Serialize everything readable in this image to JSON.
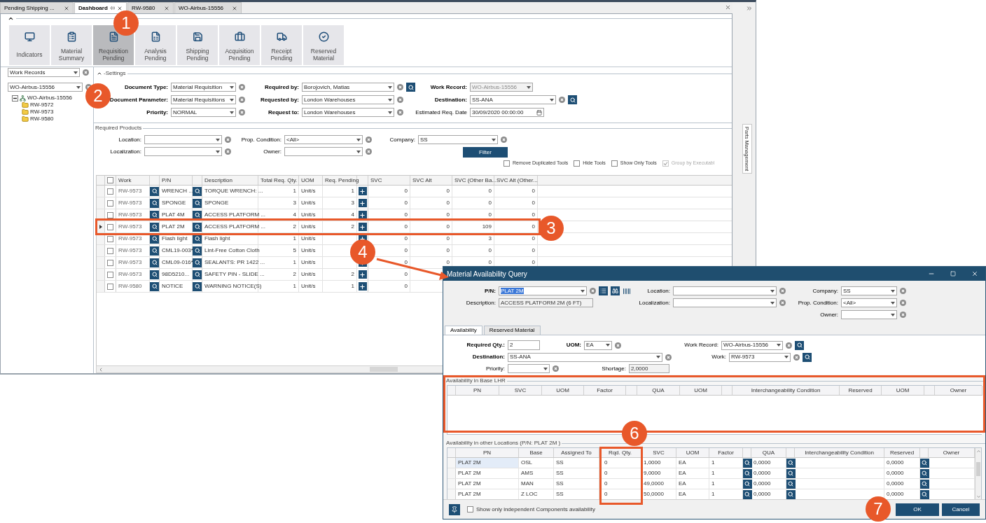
{
  "main_window": {
    "tabs": [
      {
        "label": "Pending Shipping ...",
        "selected": false,
        "pinned": false
      },
      {
        "label": "Dashboard",
        "selected": true,
        "pinned": true
      },
      {
        "label": "RW-9580",
        "selected": false,
        "pinned": false
      },
      {
        "label": "WO-Airbus-15556",
        "selected": false,
        "pinned": false
      }
    ],
    "tiles": [
      {
        "label": "Indicators",
        "selected": false
      },
      {
        "label": "Material Summary",
        "selected": false
      },
      {
        "label": "Requisition Pending",
        "selected": true
      },
      {
        "label": "Analysis Pending",
        "selected": false
      },
      {
        "label": "Shipping Pending",
        "selected": false
      },
      {
        "label": "Acquisition Pending",
        "selected": false
      },
      {
        "label": "Receipt Pending",
        "selected": false
      },
      {
        "label": "Reserved Material",
        "selected": false
      }
    ],
    "left_panel": {
      "filter": "Work Records",
      "record": "WO-Airbus-15556",
      "tree": [
        {
          "label": "WO-Airbus-15556",
          "expanded": true,
          "children": [
            {
              "label": "RW-9572"
            },
            {
              "label": "RW-9573"
            },
            {
              "label": "RW-9580"
            }
          ]
        }
      ]
    },
    "settings": {
      "title": "-Settings",
      "rows": [
        [
          {
            "label": "Document Type:",
            "value": "Material Requisition",
            "kind": "dropdown",
            "required": true
          },
          {
            "label": "Required by:",
            "value": "Borojovich, Matias",
            "kind": "dropdown",
            "required": true,
            "search": true
          },
          {
            "label": "Work Record:",
            "value": "WO-Airbus-15556",
            "kind": "dropdown",
            "required": true,
            "disabled": true
          }
        ],
        [
          {
            "label": "Document Parameter:",
            "value": "Material Requisitions",
            "kind": "dropdown",
            "required": true
          },
          {
            "label": "Requested by:",
            "value": "London Warehouses",
            "kind": "dropdown",
            "required": true
          },
          {
            "label": "Destination:",
            "value": "SS-ANA",
            "kind": "dropdown",
            "required": true,
            "search": true
          }
        ],
        [
          {
            "label": "Priority:",
            "value": "NORMAL",
            "kind": "dropdown",
            "required": true
          },
          {
            "label": "Request to:",
            "value": "London Warehouses",
            "kind": "dropdown",
            "required": true
          },
          {
            "label": "Estimated Req. Date",
            "value": "30/09/2020 00:00:00",
            "kind": "date",
            "required": false
          }
        ]
      ]
    },
    "required_products": {
      "title": "Required Products",
      "rows": [
        [
          {
            "label": "Location:",
            "kind": "dropdown",
            "required": false
          },
          {
            "label": "Prop. Condition:",
            "value": "<All>",
            "kind": "dropdown",
            "required": false
          },
          {
            "label": "Company:",
            "value": "SS",
            "kind": "dropdown",
            "required": false
          }
        ],
        [
          {
            "label": "Localization:",
            "kind": "dropdown",
            "required": false
          },
          {
            "label": "Owner:",
            "kind": "dropdown",
            "required": false
          }
        ]
      ],
      "filter_button": "Filter"
    },
    "options": [
      {
        "label": "Remove Duplicated Tools",
        "checked": false,
        "disabled": false
      },
      {
        "label": "Hide Tools",
        "checked": false,
        "disabled": false
      },
      {
        "label": "Show Only Tools",
        "checked": false,
        "disabled": false
      },
      {
        "label": "Group by Executabl",
        "checked": true,
        "disabled": true
      }
    ],
    "table": {
      "select_all_checked": false,
      "columns": [
        "Work",
        "P/N",
        "Description",
        "Total Req. Qty.",
        "UOM",
        "Req. Pending",
        "SVC",
        "SVC Alt",
        "SVC (Other Ba...",
        "SVC Alt (Other..."
      ],
      "rows": [
        {
          "selected": false,
          "checked": false,
          "work": "RW-9573",
          "pn": "WRENCH ...",
          "description": "TORQUE WRENCH: ...",
          "total": "1",
          "uom": "Unit/s",
          "pending": "1",
          "svc": "0",
          "svc_alt": "0",
          "svc_other": "0",
          "svc_alt_other": "0"
        },
        {
          "selected": false,
          "checked": false,
          "work": "RW-9573",
          "pn": "SPONGE",
          "description": "SPONGE",
          "total": "3",
          "uom": "Unit/s",
          "pending": "3",
          "svc": "0",
          "svc_alt": "0",
          "svc_other": "0",
          "svc_alt_other": "0"
        },
        {
          "selected": false,
          "checked": false,
          "work": "RW-9573",
          "pn": "PLAT 4M",
          "description": "ACCESS PLATFORM ...",
          "total": "4",
          "uom": "Unit/s",
          "pending": "4",
          "svc": "0",
          "svc_alt": "0",
          "svc_other": "0",
          "svc_alt_other": "0"
        },
        {
          "selected": true,
          "checked": false,
          "work": "RW-9573",
          "pn": "PLAT 2M",
          "description": "ACCESS PLATFORM ...",
          "total": "2",
          "uom": "Unit/s",
          "pending": "2",
          "svc": "0",
          "svc_alt": "0",
          "svc_other": "109",
          "svc_alt_other": "0"
        },
        {
          "selected": false,
          "checked": false,
          "work": "RW-9573",
          "pn": "Flash light",
          "description": "Flash light",
          "total": "1",
          "uom": "Unit/s",
          "svc": "0",
          "svc_alt": "0",
          "svc_other": "3",
          "svc_alt_other": "0"
        },
        {
          "selected": false,
          "checked": false,
          "work": "RW-9573",
          "pn": "CML19-003*",
          "description": "Lint-Free Cotton Cloth",
          "total": "5",
          "uom": "Unit/s",
          "svc": "0",
          "svc_alt": "0",
          "svc_other": "0",
          "svc_alt_other": "0"
        },
        {
          "selected": false,
          "checked": false,
          "work": "RW-9573",
          "pn": "CML09-016*",
          "description": "SEALANTS: PR 1422 ...",
          "total": "1",
          "uom": "Unit/s",
          "svc": "0",
          "svc_alt": "0",
          "svc_other": "0",
          "svc_alt_other": "0"
        },
        {
          "selected": false,
          "checked": false,
          "work": "RW-9573",
          "pn": "98D5210...",
          "description": "SAFETY PIN - SLIDE ...",
          "total": "2",
          "uom": "Unit/s",
          "pending": "2",
          "svc": "0"
        },
        {
          "selected": false,
          "checked": false,
          "work": "RW-9580",
          "pn": "NOTICE",
          "description": "WARNING NOTICE(S)",
          "total": "1",
          "uom": "Unit/s",
          "pending": "1",
          "svc": "0"
        }
      ]
    },
    "side_panel": "Parts Management"
  },
  "dialog": {
    "title": "Material Availability Query",
    "query_columns": [
      [
        {
          "label": "P/N:",
          "value": "PLAT 2M",
          "kind": "dropdown",
          "required": true,
          "text_selected": true
        },
        {
          "label": "Description:",
          "value": "ACCESS PLATFORM 2M (6 FT)",
          "kind": "readonly",
          "required": false
        }
      ],
      [
        {
          "label": "Location:",
          "kind": "dropdown",
          "required": false
        },
        {
          "label": "Localization:",
          "kind": "dropdown",
          "required": false
        }
      ],
      [
        {
          "label": "Company:",
          "value": "SS",
          "kind": "dropdown",
          "required": false
        },
        {
          "label": "Prop. Condition:",
          "value": "<All>",
          "kind": "dropdown",
          "required": false
        },
        {
          "label": "Owner:",
          "kind": "dropdown",
          "required": false
        }
      ]
    ],
    "tabs": [
      {
        "label": "Availability",
        "selected": true
      },
      {
        "label": "Reserved Material",
        "selected": false
      }
    ],
    "form": {
      "required_qty": {
        "label": "Required Qty.:",
        "value": "2",
        "kind": "text",
        "required": true
      },
      "uom": {
        "label": "UOM:",
        "value": "EA",
        "kind": "dropdown",
        "required": true
      },
      "work_record": {
        "label": "Work Record:",
        "value": "WO-Airbus-15556",
        "kind": "dropdown",
        "required": false,
        "search": true
      },
      "destination": {
        "label": "Destination:",
        "value": "SS-ANA",
        "kind": "dropdown",
        "required": true
      },
      "work": {
        "label": "Work:",
        "value": "RW-9573",
        "kind": "dropdown",
        "required": false,
        "search": true
      },
      "priority": {
        "label": "Priority:",
        "kind": "dropdown",
        "required": false
      },
      "shortage": {
        "label": "Shortage:",
        "value": "2,0000",
        "kind": "readonly",
        "required": false
      }
    },
    "base_grid": {
      "title": "Availability in Base LHR",
      "columns": [
        {
          "kind": "text",
          "label": "PN"
        },
        {
          "kind": "text",
          "label": "SVC"
        },
        {
          "kind": "text",
          "label": "UOM"
        },
        {
          "kind": "text",
          "label": "Factor"
        },
        {
          "kind": "icon"
        },
        {
          "kind": "text",
          "label": "QUA"
        },
        {
          "kind": "text",
          "label": "UOM"
        },
        {
          "kind": "icon"
        },
        {
          "kind": "text",
          "label": "Interchangeability Condition"
        },
        {
          "kind": "text",
          "label": "Reserved"
        },
        {
          "kind": "text",
          "label": "UOM"
        },
        {
          "kind": "icon"
        },
        {
          "kind": "text",
          "label": "Owner"
        }
      ]
    },
    "other_grid": {
      "title": "Availability in other Locations (P/N: PLAT 2M )",
      "columns": [
        {
          "kind": "text",
          "label": "PN"
        },
        {
          "kind": "text",
          "label": "Base"
        },
        {
          "kind": "text",
          "label": "Assigned To"
        },
        {
          "kind": "text",
          "label": "Rqd. Qty."
        },
        {
          "kind": "text",
          "label": "SVC"
        },
        {
          "kind": "text",
          "label": "UOM"
        },
        {
          "kind": "text",
          "label": "Factor"
        },
        {
          "kind": "icon"
        },
        {
          "kind": "text",
          "label": "QUA"
        },
        {
          "kind": "icon"
        },
        {
          "kind": "text",
          "label": "Interchangeability Condition"
        },
        {
          "kind": "text",
          "label": "Reserved"
        },
        {
          "kind": "icon"
        },
        {
          "kind": "text",
          "label": "Owner"
        }
      ],
      "rows": [
        {
          "selected": true,
          "cells": [
            "PLAT 2M",
            "OSL",
            "SS",
            "0",
            "1,0000",
            "EA",
            "1",
            "0,0000",
            "",
            "0,0000",
            ""
          ]
        },
        {
          "selected": false,
          "cells": [
            "PLAT 2M",
            "AMS",
            "SS",
            "0",
            "9,0000",
            "EA",
            "1",
            "0,0000",
            "",
            "0,0000",
            ""
          ]
        },
        {
          "selected": false,
          "cells": [
            "PLAT 2M",
            "MAN",
            "SS",
            "0",
            "49,0000",
            "EA",
            "1",
            "0,0000",
            "",
            "0,0000",
            ""
          ]
        },
        {
          "selected": false,
          "cells": [
            "PLAT 2M",
            "Z LOC",
            "SS",
            "0",
            "50,0000",
            "EA",
            "1",
            "0,0000",
            "",
            "0,0000",
            ""
          ]
        }
      ]
    },
    "independent_only": {
      "label": "Show only independent Components availability",
      "checked": false
    },
    "buttons": [
      "OK",
      "Cancel"
    ]
  },
  "callouts": [
    "1",
    "2",
    "3",
    "4",
    "6",
    "7"
  ]
}
